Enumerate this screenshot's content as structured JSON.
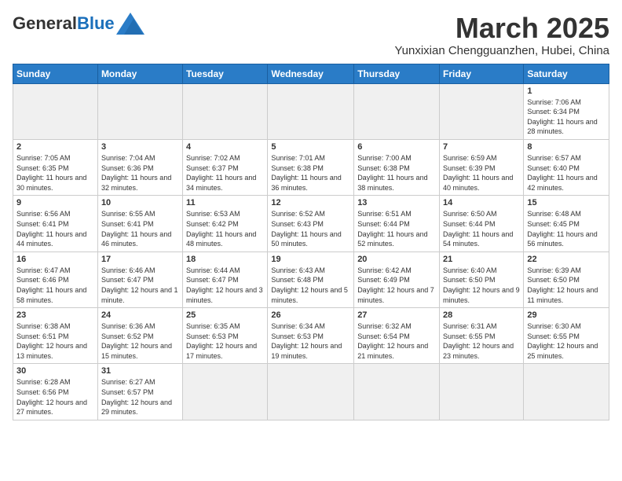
{
  "header": {
    "logo_general": "General",
    "logo_blue": "Blue",
    "month": "March 2025",
    "location": "Yunxixian Chengguanzhen, Hubei, China"
  },
  "weekdays": [
    "Sunday",
    "Monday",
    "Tuesday",
    "Wednesday",
    "Thursday",
    "Friday",
    "Saturday"
  ],
  "days": [
    {
      "num": "",
      "sunrise": "",
      "sunset": "",
      "daylight": "",
      "empty": true
    },
    {
      "num": "",
      "sunrise": "",
      "sunset": "",
      "daylight": "",
      "empty": true
    },
    {
      "num": "",
      "sunrise": "",
      "sunset": "",
      "daylight": "",
      "empty": true
    },
    {
      "num": "",
      "sunrise": "",
      "sunset": "",
      "daylight": "",
      "empty": true
    },
    {
      "num": "",
      "sunrise": "",
      "sunset": "",
      "daylight": "",
      "empty": true
    },
    {
      "num": "",
      "sunrise": "",
      "sunset": "",
      "daylight": "",
      "empty": true
    },
    {
      "num": "1",
      "sunrise": "Sunrise: 7:06 AM",
      "sunset": "Sunset: 6:34 PM",
      "daylight": "Daylight: 11 hours and 28 minutes.",
      "empty": false
    },
    {
      "num": "2",
      "sunrise": "Sunrise: 7:05 AM",
      "sunset": "Sunset: 6:35 PM",
      "daylight": "Daylight: 11 hours and 30 minutes.",
      "empty": false
    },
    {
      "num": "3",
      "sunrise": "Sunrise: 7:04 AM",
      "sunset": "Sunset: 6:36 PM",
      "daylight": "Daylight: 11 hours and 32 minutes.",
      "empty": false
    },
    {
      "num": "4",
      "sunrise": "Sunrise: 7:02 AM",
      "sunset": "Sunset: 6:37 PM",
      "daylight": "Daylight: 11 hours and 34 minutes.",
      "empty": false
    },
    {
      "num": "5",
      "sunrise": "Sunrise: 7:01 AM",
      "sunset": "Sunset: 6:38 PM",
      "daylight": "Daylight: 11 hours and 36 minutes.",
      "empty": false
    },
    {
      "num": "6",
      "sunrise": "Sunrise: 7:00 AM",
      "sunset": "Sunset: 6:38 PM",
      "daylight": "Daylight: 11 hours and 38 minutes.",
      "empty": false
    },
    {
      "num": "7",
      "sunrise": "Sunrise: 6:59 AM",
      "sunset": "Sunset: 6:39 PM",
      "daylight": "Daylight: 11 hours and 40 minutes.",
      "empty": false
    },
    {
      "num": "8",
      "sunrise": "Sunrise: 6:57 AM",
      "sunset": "Sunset: 6:40 PM",
      "daylight": "Daylight: 11 hours and 42 minutes.",
      "empty": false
    },
    {
      "num": "9",
      "sunrise": "Sunrise: 6:56 AM",
      "sunset": "Sunset: 6:41 PM",
      "daylight": "Daylight: 11 hours and 44 minutes.",
      "empty": false
    },
    {
      "num": "10",
      "sunrise": "Sunrise: 6:55 AM",
      "sunset": "Sunset: 6:41 PM",
      "daylight": "Daylight: 11 hours and 46 minutes.",
      "empty": false
    },
    {
      "num": "11",
      "sunrise": "Sunrise: 6:53 AM",
      "sunset": "Sunset: 6:42 PM",
      "daylight": "Daylight: 11 hours and 48 minutes.",
      "empty": false
    },
    {
      "num": "12",
      "sunrise": "Sunrise: 6:52 AM",
      "sunset": "Sunset: 6:43 PM",
      "daylight": "Daylight: 11 hours and 50 minutes.",
      "empty": false
    },
    {
      "num": "13",
      "sunrise": "Sunrise: 6:51 AM",
      "sunset": "Sunset: 6:44 PM",
      "daylight": "Daylight: 11 hours and 52 minutes.",
      "empty": false
    },
    {
      "num": "14",
      "sunrise": "Sunrise: 6:50 AM",
      "sunset": "Sunset: 6:44 PM",
      "daylight": "Daylight: 11 hours and 54 minutes.",
      "empty": false
    },
    {
      "num": "15",
      "sunrise": "Sunrise: 6:48 AM",
      "sunset": "Sunset: 6:45 PM",
      "daylight": "Daylight: 11 hours and 56 minutes.",
      "empty": false
    },
    {
      "num": "16",
      "sunrise": "Sunrise: 6:47 AM",
      "sunset": "Sunset: 6:46 PM",
      "daylight": "Daylight: 11 hours and 58 minutes.",
      "empty": false
    },
    {
      "num": "17",
      "sunrise": "Sunrise: 6:46 AM",
      "sunset": "Sunset: 6:47 PM",
      "daylight": "Daylight: 12 hours and 1 minute.",
      "empty": false
    },
    {
      "num": "18",
      "sunrise": "Sunrise: 6:44 AM",
      "sunset": "Sunset: 6:47 PM",
      "daylight": "Daylight: 12 hours and 3 minutes.",
      "empty": false
    },
    {
      "num": "19",
      "sunrise": "Sunrise: 6:43 AM",
      "sunset": "Sunset: 6:48 PM",
      "daylight": "Daylight: 12 hours and 5 minutes.",
      "empty": false
    },
    {
      "num": "20",
      "sunrise": "Sunrise: 6:42 AM",
      "sunset": "Sunset: 6:49 PM",
      "daylight": "Daylight: 12 hours and 7 minutes.",
      "empty": false
    },
    {
      "num": "21",
      "sunrise": "Sunrise: 6:40 AM",
      "sunset": "Sunset: 6:50 PM",
      "daylight": "Daylight: 12 hours and 9 minutes.",
      "empty": false
    },
    {
      "num": "22",
      "sunrise": "Sunrise: 6:39 AM",
      "sunset": "Sunset: 6:50 PM",
      "daylight": "Daylight: 12 hours and 11 minutes.",
      "empty": false
    },
    {
      "num": "23",
      "sunrise": "Sunrise: 6:38 AM",
      "sunset": "Sunset: 6:51 PM",
      "daylight": "Daylight: 12 hours and 13 minutes.",
      "empty": false
    },
    {
      "num": "24",
      "sunrise": "Sunrise: 6:36 AM",
      "sunset": "Sunset: 6:52 PM",
      "daylight": "Daylight: 12 hours and 15 minutes.",
      "empty": false
    },
    {
      "num": "25",
      "sunrise": "Sunrise: 6:35 AM",
      "sunset": "Sunset: 6:53 PM",
      "daylight": "Daylight: 12 hours and 17 minutes.",
      "empty": false
    },
    {
      "num": "26",
      "sunrise": "Sunrise: 6:34 AM",
      "sunset": "Sunset: 6:53 PM",
      "daylight": "Daylight: 12 hours and 19 minutes.",
      "empty": false
    },
    {
      "num": "27",
      "sunrise": "Sunrise: 6:32 AM",
      "sunset": "Sunset: 6:54 PM",
      "daylight": "Daylight: 12 hours and 21 minutes.",
      "empty": false
    },
    {
      "num": "28",
      "sunrise": "Sunrise: 6:31 AM",
      "sunset": "Sunset: 6:55 PM",
      "daylight": "Daylight: 12 hours and 23 minutes.",
      "empty": false
    },
    {
      "num": "29",
      "sunrise": "Sunrise: 6:30 AM",
      "sunset": "Sunset: 6:55 PM",
      "daylight": "Daylight: 12 hours and 25 minutes.",
      "empty": false
    },
    {
      "num": "30",
      "sunrise": "Sunrise: 6:28 AM",
      "sunset": "Sunset: 6:56 PM",
      "daylight": "Daylight: 12 hours and 27 minutes.",
      "empty": false
    },
    {
      "num": "31",
      "sunrise": "Sunrise: 6:27 AM",
      "sunset": "Sunset: 6:57 PM",
      "daylight": "Daylight: 12 hours and 29 minutes.",
      "empty": false
    },
    {
      "num": "",
      "sunrise": "",
      "sunset": "",
      "daylight": "",
      "empty": true
    },
    {
      "num": "",
      "sunrise": "",
      "sunset": "",
      "daylight": "",
      "empty": true
    },
    {
      "num": "",
      "sunrise": "",
      "sunset": "",
      "daylight": "",
      "empty": true
    },
    {
      "num": "",
      "sunrise": "",
      "sunset": "",
      "daylight": "",
      "empty": true
    },
    {
      "num": "",
      "sunrise": "",
      "sunset": "",
      "daylight": "",
      "empty": true
    }
  ]
}
